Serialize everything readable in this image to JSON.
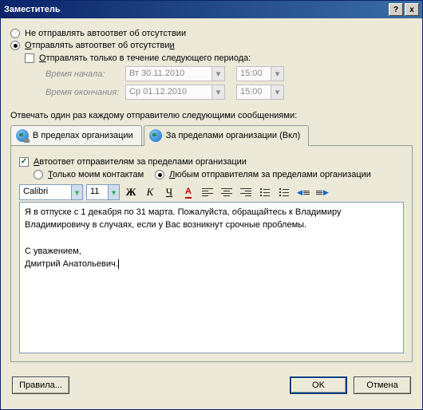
{
  "title": "Заместитель",
  "help_btn": "?",
  "close_btn": "x",
  "radio_no_send": "Не отправлять автоответ об отсутствии",
  "radio_send_prefix": "О",
  "radio_send": "тправлять автоответ об отсутстви",
  "radio_send_u2": "и",
  "period_prefix": "О",
  "period": "тправлять только в течение следующего периода:",
  "dt_start_label": "Время начала:",
  "dt_end_label": "Время окончания:",
  "dt_start_date": "Вт 30.11.2010",
  "dt_end_date": "Ср 01.12.2010",
  "dt_start_time": "15:00",
  "dt_end_time": "15:00",
  "reply_label": "Отвечать один раз каждому отправителю следующими сообщениями:",
  "tab1": "В пределах организации",
  "tab2": "За пределами организации (Вкл)",
  "chk_outside_prefix": "А",
  "chk_outside": "втоответ отправителям за пределами организации",
  "radio_contacts_prefix": "Т",
  "radio_contacts": "олько моим контактам",
  "radio_any_prefix": "Л",
  "radio_any": "юбым отправителям за пределами организации",
  "font_name": "Calibri",
  "font_size": "11",
  "bold": "Ж",
  "italic": "К",
  "uline": "Ч",
  "A": "A",
  "message": "Я в отпуске с 1 декабря по 31 марта. Пожалуйста, обращайтесь к Владимиру Владимировичу в случаях, если у Вас возникнут срочные проблемы.\n\nС уважением,\nДмитрий Анатольевич.",
  "rules_btn": "Правила...",
  "ok_btn": "OK",
  "cancel_btn": "Отмена",
  "dd_glyph": "▾"
}
